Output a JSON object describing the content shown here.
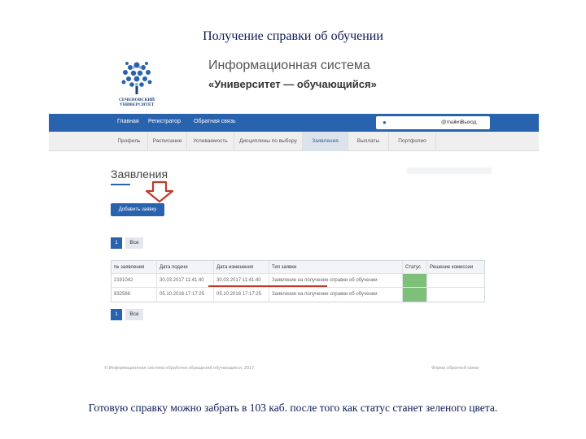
{
  "slide": {
    "title": "Получение справки об обучении",
    "caption": "Готовую справку можно забрать в 103 каб. после того как статус станет зеленого цвета."
  },
  "header": {
    "logo_text_line1": "СЕЧЕНОВСКИЙ",
    "logo_text_line2": "УНИВЕРСИТЕТ",
    "system_title": "Информационная система",
    "system_subtitle": "«Университет — обучающийся»"
  },
  "topnav": {
    "items": [
      "Главная",
      "Регистратор",
      "Обратная связь"
    ],
    "login_mail": "@mail.ru",
    "logout_label": "Выход"
  },
  "subnav": {
    "tabs": [
      "Профиль",
      "Расписание",
      "Успеваемость",
      "Дисциплины по выбору",
      "Заявления",
      "Выплаты",
      "Портфолио"
    ],
    "active": "Заявления"
  },
  "content": {
    "heading": "Заявления",
    "add_button": "Добавить заявку",
    "pager_page": "1",
    "pager_all": "Все"
  },
  "table": {
    "columns": [
      "№ заявления",
      "Дата подачи",
      "Дата изменения",
      "Тип заявки",
      "Статус",
      "Решение комиссии"
    ],
    "rows": [
      [
        "2191042",
        "30.03.2017 11:41:40",
        "30.03.2017 11:41:40",
        "Заявление на получение справки об обучении",
        "",
        ""
      ],
      [
        "832566",
        "05.10.2016 17:17:25",
        "05.10.2016 17:17:25",
        "Заявление на получение справки об обучении",
        "",
        ""
      ]
    ],
    "status_color": "#7ec07a"
  },
  "footer": {
    "copyright": "© Информационная система обработки обращений обучающихся, 2017",
    "feedback": "Форма обратной связи"
  },
  "colors": {
    "nav_blue": "#2a63ad",
    "arrow_red": "#c0392b"
  }
}
